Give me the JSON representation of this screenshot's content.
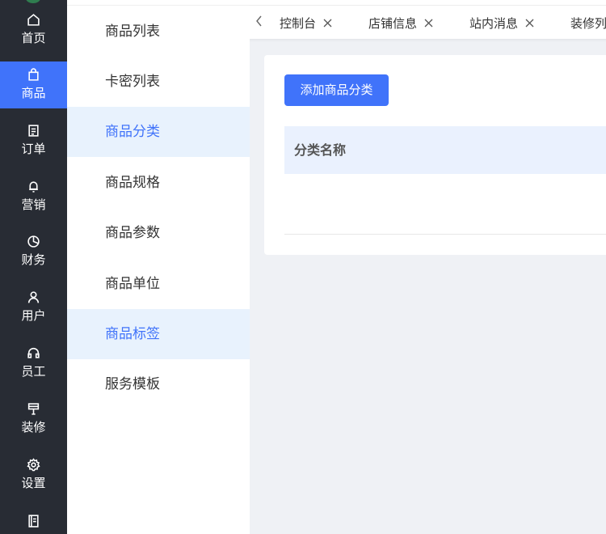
{
  "nav": {
    "items": [
      {
        "label": "首页",
        "icon": "home-icon",
        "active": false
      },
      {
        "label": "商品",
        "icon": "shopping-bag-icon",
        "active": true
      },
      {
        "label": "订单",
        "icon": "order-doc-icon",
        "active": false
      },
      {
        "label": "营销",
        "icon": "bell-icon",
        "active": false
      },
      {
        "label": "财务",
        "icon": "pie-chart-icon",
        "active": false
      },
      {
        "label": "用户",
        "icon": "user-icon",
        "active": false
      },
      {
        "label": "员工",
        "icon": "headset-icon",
        "active": false
      },
      {
        "label": "装修",
        "icon": "paint-brush-icon",
        "active": false
      },
      {
        "label": "设置",
        "icon": "gear-icon",
        "active": false
      }
    ]
  },
  "submenu": {
    "items": [
      {
        "label": "商品列表",
        "active": false
      },
      {
        "label": "卡密列表",
        "active": false
      },
      {
        "label": "商品分类",
        "active": true
      },
      {
        "label": "商品规格",
        "active": false
      },
      {
        "label": "商品参数",
        "active": false
      },
      {
        "label": "商品单位",
        "active": false
      },
      {
        "label": "商品标签",
        "active": true
      },
      {
        "label": "服务模板",
        "active": false
      }
    ]
  },
  "tabs": [
    {
      "label": "控制台"
    },
    {
      "label": "店铺信息"
    },
    {
      "label": "站内消息"
    },
    {
      "label": "装修列"
    }
  ],
  "main": {
    "add_button_label": "添加商品分类",
    "table": {
      "columns": [
        "分类名称"
      ]
    }
  },
  "colors": {
    "nav_bg": "#282c34",
    "accent": "#4073fa",
    "submenu_active_bg": "#e8f2fd",
    "table_head_bg": "#eaf1fe",
    "page_bg": "#eff1f5"
  }
}
